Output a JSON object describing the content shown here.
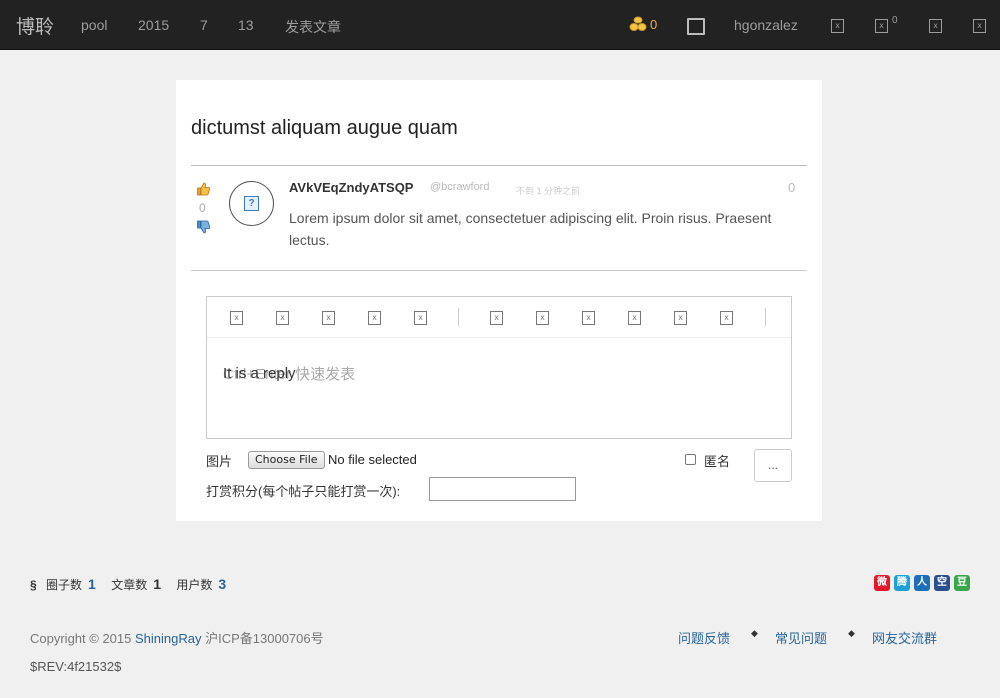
{
  "nav": {
    "brand": "博聆",
    "links": [
      "pool",
      "2015",
      "7",
      "13",
      "发表文章"
    ],
    "coins": "0",
    "user": "hgonzalez",
    "notify_count": "0"
  },
  "post": {
    "title": "dictumst aliquam augue quam",
    "vote_count": "0",
    "author": "AVkVEqZndyATSQP",
    "handle": "@bcrawford",
    "time": "不到 1 分钟之前",
    "comment_count": "0",
    "body": "Lorem ipsum dolor sit amet, consectetuer adipiscing elit. Proin risus. Praesent lectus."
  },
  "editor": {
    "placeholder": "Ctrl+Enter 快速发表",
    "draft": "It is a reply",
    "image_label": "图片",
    "file_button": "Choose File",
    "file_status": "No file selected",
    "anon_label": "匿名",
    "more_label": "...",
    "tip_label": "打赏积分(每个帖子只能打赏一次):"
  },
  "footer": {
    "section_mark": "§",
    "circles_label": "圈子数",
    "circles": "1",
    "articles_label": "文章数",
    "articles": "1",
    "users_label": "用户数",
    "users": "3",
    "copyright_prefix": "Copyright © 2015",
    "company": "ShiningRay",
    "icp": "沪ICP备13000706号",
    "links": [
      "问题反馈",
      "常见问题",
      "网友交流群"
    ],
    "rev": "$REV:4f21532$"
  },
  "share_icons": [
    "weibo-icon",
    "tencent-weibo-icon",
    "renren-icon",
    "qzone-icon",
    "douban-icon"
  ],
  "colors": {
    "topbar": "#222222",
    "link": "#2a6496",
    "coin": "#f0ad4e"
  }
}
